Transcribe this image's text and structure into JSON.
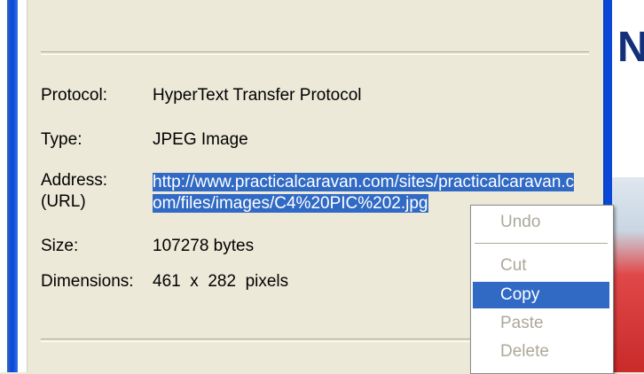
{
  "properties": {
    "protocol": {
      "label": "Protocol:",
      "value": "HyperText Transfer Protocol"
    },
    "type": {
      "label": "Type:",
      "value": "JPEG Image"
    },
    "address": {
      "label_line1": "Address:",
      "label_line2": "(URL)",
      "value": "http://www.practicalcaravan.com/sites/practicalcaravan.com/files/images/C4%20PIC%202.jpg"
    },
    "size": {
      "label": "Size:",
      "value": "107278 bytes"
    },
    "dimensions": {
      "label": "Dimensions:",
      "value": "461  x  282  pixels"
    }
  },
  "background_window": {
    "title_fragment": "Ne"
  },
  "context_menu": {
    "undo": "Undo",
    "cut": "Cut",
    "copy": "Copy",
    "paste": "Paste",
    "delete": "Delete",
    "highlighted_item": "Copy"
  },
  "colors": {
    "selection": "#316ac5",
    "dialog_bg": "#ece9d8",
    "disabled_text": "#aca899"
  }
}
